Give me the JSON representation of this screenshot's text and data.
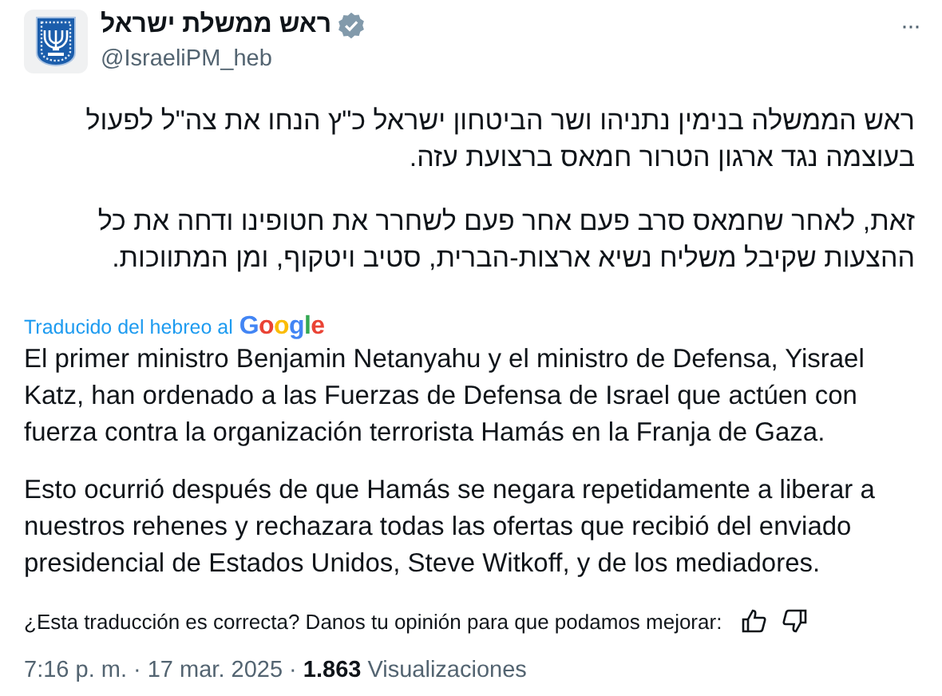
{
  "author": {
    "name": "ראש ממשלת ישראל",
    "verified": true,
    "handle": "@IsraeliPM_heb",
    "more": "···"
  },
  "original_paragraphs": [
    "ראש הממשלה בנימין נתניהו ושר הביטחון ישראל כ\"ץ הנחו את צה\"ל לפעול בעוצמה נגד ארגון הטרור חמאס ברצועת עזה.",
    "זאת, לאחר שחמאס סרב פעם אחר פעם לשחרר את חטופינו ודחה את כל ההצעות שקיבל משליח נשיא ארצות-הברית, סטיב ויטקוף, ומן המתווכות."
  ],
  "translation": {
    "label": "Traducido del hebreo al",
    "provider": "Google",
    "paragraphs": [
      "El primer ministro Benjamin Netanyahu y el ministro de Defensa, Yisrael Katz, han ordenado a las Fuerzas de Defensa de Israel que actúen con fuerza contra la organización terrorista Hamás en la Franja de Gaza.",
      "Esto ocurrió después de que Hamás se negara repetidamente a liberar a nuestros rehenes y rechazara todas las ofertas que recibió del enviado presidencial de Estados Unidos, Steve Witkoff, y de los mediadores."
    ]
  },
  "feedback": {
    "question": "¿Esta traducción es correcta? Danos tu opinión para que podamos mejorar:"
  },
  "meta": "7:16 p. m. · 17 mar. 2025 · **1.863** Visualizaciones"
}
